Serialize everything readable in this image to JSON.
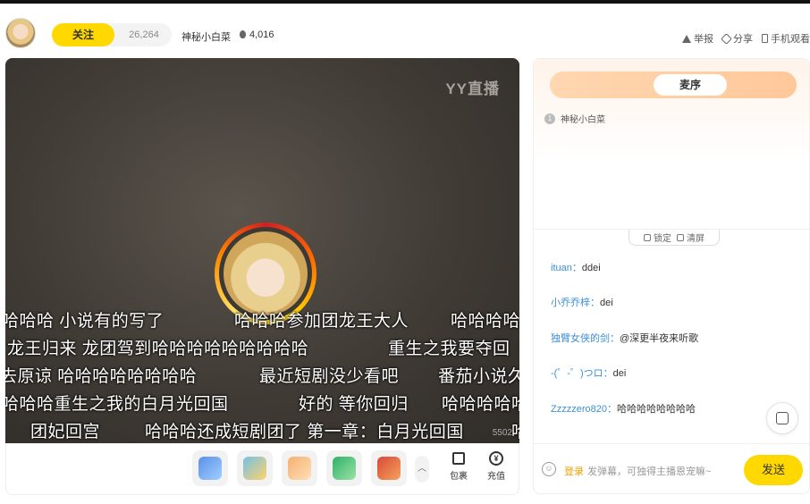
{
  "header": {
    "follow_label": "关注",
    "follow_count": "26,264",
    "anchor_name": "神秘小白菜",
    "heat": "4,016",
    "report": "举报",
    "share": "分享",
    "mobile": "手机观看"
  },
  "player": {
    "logo": "YY直播",
    "corner_number": "5502",
    "danmu_rows": [
      [
        "哈哈哈  小说有的写了",
        "哈哈哈参加团龙王大人",
        "哈哈哈哈"
      ],
      [
        "龙王归来  龙团驾到哈哈哈哈哈哈哈哈哈",
        "重生之我要夺回"
      ],
      [
        "去原谅 哈哈哈哈哈哈哈哈",
        "最近短剧没少看吧",
        "番茄小说久"
      ],
      [
        "哈哈哈重生之我的白月光回国",
        "好的 等你回归",
        "哈哈哈哈哈"
      ],
      [
        "团妃回宫",
        "哈哈哈还成短剧团了  第一章：白月光回国",
        "哈"
      ]
    ]
  },
  "gifts": {
    "items": [
      {
        "name": "gift-1",
        "color": "#5c8fe8"
      },
      {
        "name": "gift-2",
        "color": "#74c0e8"
      },
      {
        "name": "gift-3",
        "color": "#f4b070"
      },
      {
        "name": "gift-4",
        "color": "#2fb06a"
      },
      {
        "name": "gift-5",
        "color": "#d84a3a"
      }
    ],
    "collapse_icon": "chevron-up-icon",
    "bag_label": "包裹",
    "recharge_label": "充值",
    "recharge_icon_text": "¥"
  },
  "side": {
    "tab_active": "麦序",
    "queue": [
      {
        "index": "1",
        "name": "神秘小白菜"
      }
    ],
    "lock_label": "锁定",
    "clear_label": "清屏",
    "chat": [
      {
        "user": "ituan：",
        "msg": "ddei"
      },
      {
        "user": "小乔乔梓：",
        "msg": "dei"
      },
      {
        "user": "独臂女侠的剑：",
        "msg": "@深更半夜来听歌"
      },
      {
        "user": "-(゜-゜)つロ：",
        "msg": "dei"
      },
      {
        "user": "Zzzzzero820：",
        "msg": "哈哈哈哈哈哈哈哈"
      }
    ],
    "login_label": "登录",
    "input_placeholder": "发弹幕，可独得主播恩宠嘛~",
    "send_label": "发送"
  },
  "colors": {
    "accent": "#ffd800",
    "user_link": "#3a8fd9",
    "login": "#f0a000"
  }
}
